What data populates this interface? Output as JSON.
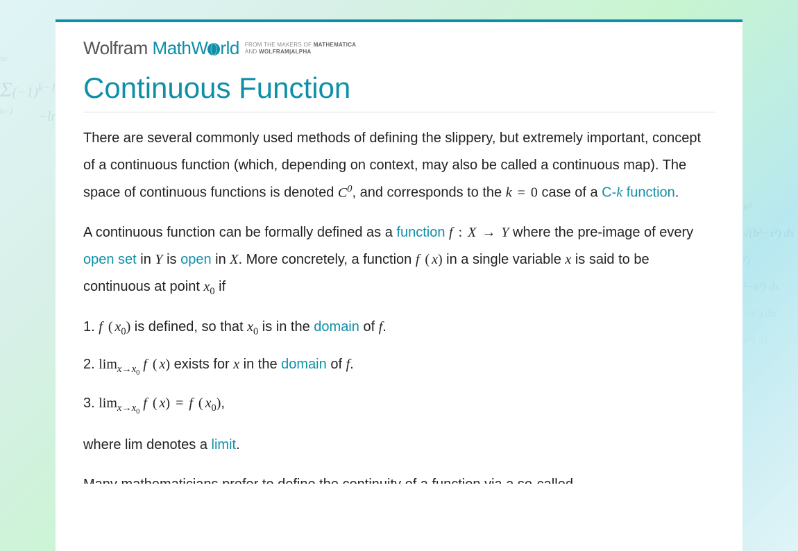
{
  "logo": {
    "wolfram": "Wolfram",
    "math": "Math",
    "rld": "rld",
    "sub_line1_a": "FROM THE MAKERS OF ",
    "sub_line1_b": "MATHEMATICA",
    "sub_line2_a": "AND ",
    "sub_line2_b": "WOLFRAM|ALPHA"
  },
  "title": "Continuous Function",
  "links": {
    "ck_function": "C-k function",
    "function": "function",
    "open_set": "open set",
    "open": "open",
    "domain": "domain",
    "limit": "limit"
  },
  "text": {
    "p1_a": "There are several commonly used methods of defining the slippery, but extremely important, concept of a continuous function (which, depending on context, may also be called a continuous map). The space of continuous functions is denoted ",
    "p1_b": ", and corresponds to the ",
    "p1_c": " case of a ",
    "p1_d": ".",
    "p2_a": "A continuous function can be formally defined as a ",
    "p2_b": " where the pre-image of every ",
    "p2_c": " in ",
    "p2_d": " is ",
    "p2_e": " in ",
    "p2_f": ". More concretely, a function ",
    "p2_g": " in a single variable ",
    "p2_h": " is said to be continuous at point ",
    "p2_i": " if",
    "li1_a": "1. ",
    "li1_b": " is defined, so that ",
    "li1_c": " is in the ",
    "li1_d": " of ",
    "li1_e": ".",
    "li2_a": "2. ",
    "li2_b": " exists for ",
    "li2_c": " in the ",
    "li2_d": " of ",
    "li2_e": ".",
    "li3_a": "3. ",
    "li3_b": ",",
    "p3_a": "where lim denotes a ",
    "p3_b": ".",
    "p4": "Many mathematicians prefer to define the continuity of a function via a so-called"
  },
  "math": {
    "C0": "C",
    "C0_sup": "0",
    "k_eq_0_k": "k",
    "k_eq_0_eq": " = ",
    "k_eq_0_0": "0",
    "fXY_f": "f",
    "fXY_colon": " : ",
    "fXY_X": "X",
    "fXY_arrow": " → ",
    "fXY_Y": "Y",
    "Y": "Y",
    "X": "X",
    "fx_f": "f",
    "fx_open": " (",
    "fx_x": "x",
    "fx_close": ")",
    "x": "x",
    "x0_x": "x",
    "x0_0": "0",
    "fx0_f": "f",
    "fx0_open": " (",
    "fx0_x": "x",
    "fx0_0": "0",
    "fx0_close": ")",
    "f": "f",
    "lim": "lim",
    "lim_sub_x": "x",
    "lim_sub_arrow": "→",
    "lim_sub_x0x": "x",
    "lim_sub_x00": "0",
    "eq": " = "
  }
}
